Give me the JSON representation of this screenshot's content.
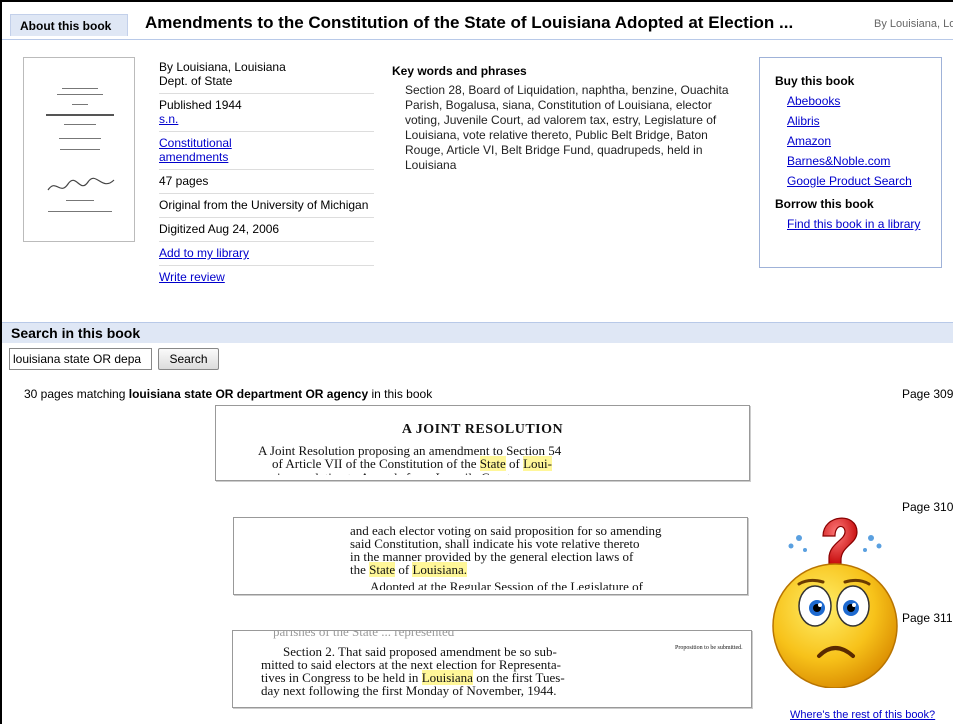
{
  "header": {
    "tab_label": "About this book",
    "title": "Amendments to the Constitution of the State of Louisiana Adopted at Election ...",
    "by_line": "By Louisiana, Louisiana"
  },
  "meta": {
    "author_line1": "By Louisiana, Louisiana",
    "author_line2": "Dept. of State",
    "published": "Published 1944",
    "publisher_link": "s.n.",
    "subject_link_1": "Constitutional",
    "subject_link_2": "amendments",
    "pages": "47 pages",
    "original_from": "Original from the University of Michigan",
    "digitized": "Digitized Aug 24, 2006",
    "add_library_link": "Add to my library",
    "write_review_link": "Write review"
  },
  "keywords": {
    "title": "Key words and phrases",
    "text": "Section 28, Board of Liquidation, naphtha, benzine, Ouachita Parish, Bogalusa, siana, Constitution of Louisiana, elector voting, Juvenile Court, ad valorem tax, estry, Legislature of Louisiana, vote relative thereto, Public Belt Bridge, Baton Rouge, Article VI, Belt Bridge Fund, quadrupeds, held in Louisiana"
  },
  "buy": {
    "title": "Buy this book",
    "links": [
      "Abebooks",
      "Alibris",
      "Amazon",
      "Barnes&Noble.com",
      "Google Product Search"
    ],
    "borrow_title": "Borrow this book",
    "borrow_link": "Find this book in a library"
  },
  "search": {
    "section_title": "Search in this book",
    "input_value": "louisiana state OR depa",
    "button_label": "Search",
    "match_prefix": "30 pages matching ",
    "match_query": "louisiana state OR department OR agency",
    "match_suffix": " in this book",
    "pages": [
      "Page 309",
      "Page 310",
      "Page 311"
    ]
  },
  "snippets": {
    "s1_heading": "A JOINT RESOLUTION",
    "s1_l1a": "A Joint Resolution proposing an amendment to Section 54",
    "s1_l2a": "of Article VII of the Constitution of the ",
    "s1_l2b": "State",
    "s1_l2c": " of ",
    "s1_l2d": "Loui-",
    "s1_l3": "siana, relative to Appeals from Juvenile Courts",
    "s2_l1": "and each elector voting on said proposition for so amending",
    "s2_l2": "said Constitution, shall indicate his vote relative thereto",
    "s2_l3": "in the manner provided by the general election laws of",
    "s2_l4a": "the ",
    "s2_l4b": "State",
    "s2_l4c": " of ",
    "s2_l4d": "Louisiana.",
    "s2_l5": "Adopted at the Regular Session of the Legislature of",
    "s3_l0": "parishes of the State ... represented",
    "s3_l1": "Section 2. That said proposed amendment be so sub-",
    "s3_l2": "mitted to said electors at the next election for Representa-",
    "s3_l3a": "tives in Congress to be held in ",
    "s3_l3b": "Louisiana",
    "s3_l3c": " on the first Tues-",
    "s3_l4": "day next following the first Monday of November, 1944.",
    "s3_margin": "Proposition to be submitted."
  },
  "footer": {
    "rest_link": "Where's the rest of this book?"
  },
  "colors": {
    "link": "#0000cc",
    "header_bg": "#dfe7f5",
    "highlight": "#fff799",
    "smiley_yellow": "#f7c21a",
    "question_red": "#e02020"
  },
  "icons": [
    "book-cover-thumbnail",
    "confused-smiley-icon",
    "question-mark-icon"
  ]
}
